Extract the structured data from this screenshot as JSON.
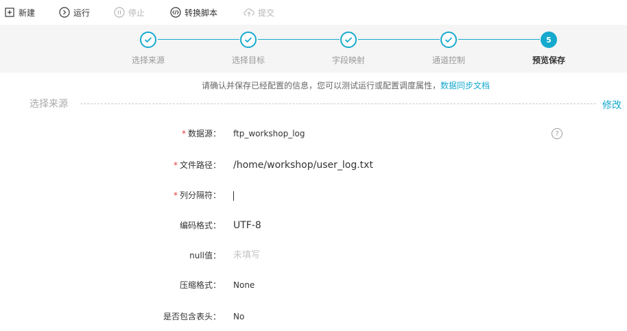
{
  "toolbar": {
    "new_label": "新建",
    "run_label": "运行",
    "stop_label": "停止",
    "convert_label": "转换脚本",
    "submit_label": "提交"
  },
  "steps": [
    {
      "label": "选择来源",
      "state": "done"
    },
    {
      "label": "选择目标",
      "state": "done"
    },
    {
      "label": "字段映射",
      "state": "done"
    },
    {
      "label": "通道控制",
      "state": "done"
    },
    {
      "label": "预览保存",
      "state": "active",
      "number": "5"
    }
  ],
  "tip": {
    "text": "请确认并保存已经配置的信息，您可以测试运行或配置调度属性，",
    "link": "数据同步文档"
  },
  "section": {
    "title": "选择来源",
    "edit_label": "修改"
  },
  "form": {
    "datasource": {
      "label": "数据源：",
      "value": "ftp_workshop_log",
      "required": true
    },
    "filepath": {
      "label": "文件路径：",
      "value": "/home/workshop/user_log.txt",
      "required": true
    },
    "separator": {
      "label": "列分隔符：",
      "value": "",
      "required": true
    },
    "encoding": {
      "label": "编码格式：",
      "value": "UTF-8"
    },
    "null_value": {
      "label": "null值：",
      "placeholder": "未填写"
    },
    "compression": {
      "label": "压缩格式：",
      "value": "None"
    },
    "header": {
      "label": "是否包含表头：",
      "value": "No"
    }
  },
  "colors": {
    "accent": "#15a9ce",
    "required": "#e4393c"
  }
}
